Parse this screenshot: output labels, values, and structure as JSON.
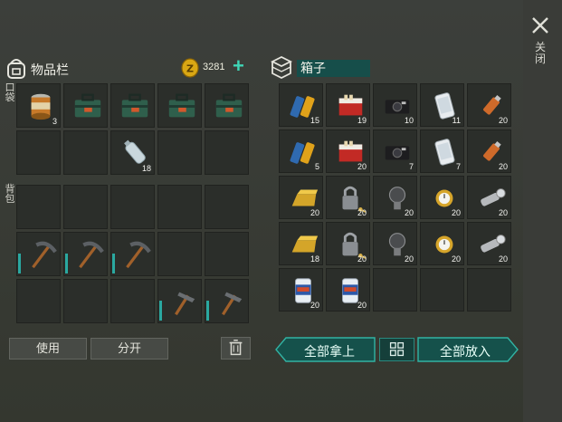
{
  "header": {
    "close_label": "关闭"
  },
  "inventory": {
    "title": "物品栏",
    "coins": "3281",
    "pocket_label": "口袋",
    "backpack_label": "背包",
    "pocket_slots": [
      {
        "item": "canned-food",
        "qty": "3"
      },
      {
        "item": "toolbox",
        "qty": ""
      },
      {
        "item": "toolbox",
        "qty": ""
      },
      {
        "item": "toolbox",
        "qty": ""
      },
      {
        "item": "toolbox",
        "qty": ""
      },
      {
        "item": "",
        "qty": ""
      },
      {
        "item": "",
        "qty": ""
      },
      {
        "item": "water-bottle",
        "qty": "18"
      },
      {
        "item": "",
        "qty": ""
      },
      {
        "item": "",
        "qty": ""
      }
    ],
    "backpack_slots": [
      {
        "item": "",
        "qty": ""
      },
      {
        "item": "",
        "qty": ""
      },
      {
        "item": "",
        "qty": ""
      },
      {
        "item": "",
        "qty": ""
      },
      {
        "item": "",
        "qty": ""
      },
      {
        "item": "pickaxe",
        "qty": ""
      },
      {
        "item": "pickaxe",
        "qty": ""
      },
      {
        "item": "pickaxe",
        "qty": ""
      },
      {
        "item": "",
        "qty": ""
      },
      {
        "item": "",
        "qty": ""
      },
      {
        "item": "",
        "qty": ""
      },
      {
        "item": "",
        "qty": ""
      },
      {
        "item": "",
        "qty": ""
      },
      {
        "item": "hammer",
        "qty": ""
      },
      {
        "item": "hammer",
        "qty": ""
      }
    ]
  },
  "box": {
    "title": "箱子",
    "slots": [
      {
        "item": "batteries",
        "qty": "15"
      },
      {
        "item": "cigarettes",
        "qty": "19"
      },
      {
        "item": "camera",
        "qty": "10"
      },
      {
        "item": "phone",
        "qty": "11"
      },
      {
        "item": "usb-drive",
        "qty": "20"
      },
      {
        "item": "batteries",
        "qty": "5"
      },
      {
        "item": "cigarettes",
        "qty": "20"
      },
      {
        "item": "camera",
        "qty": "7"
      },
      {
        "item": "phone",
        "qty": "7"
      },
      {
        "item": "usb-drive",
        "qty": "20"
      },
      {
        "item": "gold-bar",
        "qty": "20"
      },
      {
        "item": "padlock",
        "qty": "20"
      },
      {
        "item": "light-bulb",
        "qty": "20"
      },
      {
        "item": "gold-watch",
        "qty": "20"
      },
      {
        "item": "flashlight",
        "qty": "20"
      },
      {
        "item": "gold-bar",
        "qty": "18"
      },
      {
        "item": "padlock",
        "qty": "20"
      },
      {
        "item": "light-bulb",
        "qty": "20"
      },
      {
        "item": "gold-watch",
        "qty": "20"
      },
      {
        "item": "flashlight",
        "qty": "20"
      },
      {
        "item": "soda-can",
        "qty": "20"
      },
      {
        "item": "soda-can",
        "qty": "20"
      },
      {
        "item": "",
        "qty": ""
      },
      {
        "item": "",
        "qty": ""
      },
      {
        "item": "",
        "qty": ""
      }
    ]
  },
  "buttons": {
    "use": "使用",
    "split": "分开",
    "take_all": "全部拿上",
    "put_all": "全部放入"
  },
  "colors": {
    "accent": "#2aa8a0",
    "title_bg": "#164e4a"
  }
}
